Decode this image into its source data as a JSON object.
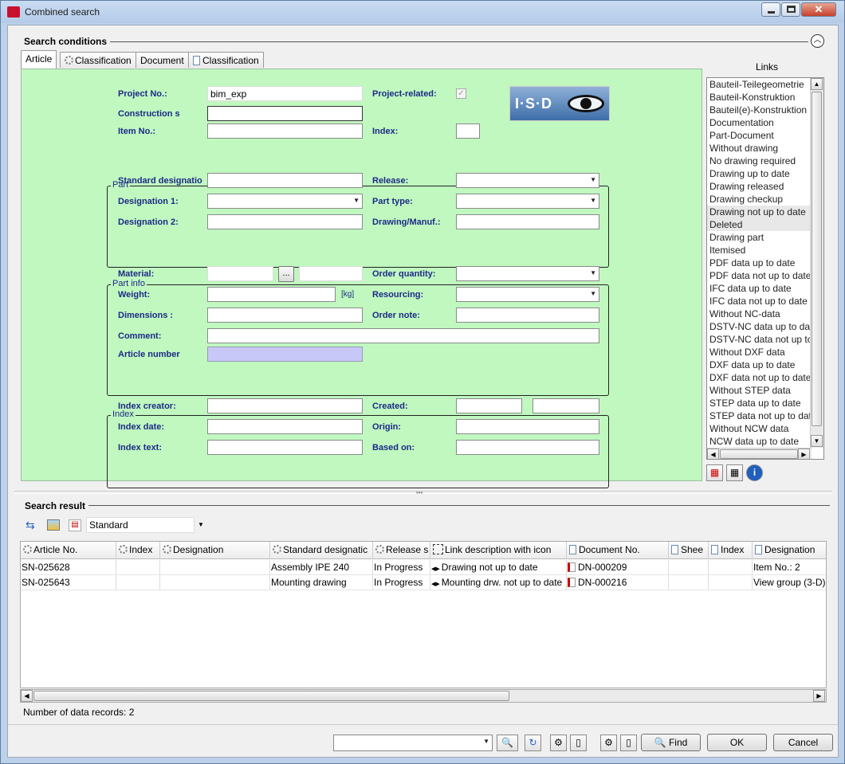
{
  "window": {
    "title": "Combined search"
  },
  "search_conditions": {
    "label": "Search conditions",
    "tabs": [
      {
        "label": "Article"
      },
      {
        "label": "Classification"
      },
      {
        "label": "Document"
      },
      {
        "label": "Classification"
      }
    ],
    "top": {
      "project_no_label": "Project No.:",
      "project_no_value": "bim_exp",
      "construction_label": "Construction s",
      "item_no_label": "Item No.:",
      "project_related_label": "Project-related:",
      "index_label": "Index:",
      "logo_text": "I·S·D"
    },
    "part": {
      "title": "Part",
      "standard_designation_label": "Standard designatio",
      "designation1_label": "Designation 1:",
      "designation2_label": "Designation 2:",
      "release_label": "Release:",
      "part_type_label": "Part type:",
      "drawing_manuf_label": "Drawing/Manuf.:"
    },
    "part_info": {
      "title": "Part info",
      "material_label": "Material:",
      "material_btn": "...",
      "weight_label": "Weight:",
      "weight_unit": "[kg]",
      "dimensions_label": "Dimensions :",
      "comment_label": "Comment:",
      "article_number_label": "Article number",
      "order_quantity_label": "Order quantity:",
      "resourcing_label": "Resourcing:",
      "order_note_label": "Order note:"
    },
    "index": {
      "title": "Index",
      "index_creator_label": "Index creator:",
      "index_date_label": "Index date:",
      "index_text_label": "Index text:",
      "created_label": "Created:",
      "origin_label": "Origin:",
      "based_on_label": "Based on:"
    }
  },
  "links": {
    "label": "Links",
    "items": [
      "Bauteil-Teilegeometrie",
      "Bauteil-Konstruktion",
      "Bauteil(e)-Konstruktion",
      "Documentation",
      "Part-Document",
      "Without drawing",
      "No drawing required",
      "Drawing up to date",
      "Drawing released",
      "Drawing checkup",
      "Drawing not up to date",
      "Deleted",
      "Drawing part",
      "Itemised",
      "PDF data up to date",
      "PDF data not up to date",
      "IFC data up to date",
      "IFC data not up to date",
      "Without NC-data",
      "DSTV-NC data up to date",
      "DSTV-NC data not up to date",
      "Without DXF data",
      "DXF data up to date",
      "DXF data not up to date",
      "Without STEP data",
      "STEP data up to date",
      "STEP data not up to date",
      "Without NCW data",
      "NCW data up to date"
    ]
  },
  "search_result": {
    "label": "Search result",
    "view_select": "Standard",
    "columns": [
      "Article No.",
      "Index",
      "Designation",
      "Standard designatic",
      "Release s",
      "Link description with icon",
      "Document No.",
      "Shee",
      "Index",
      "Designation"
    ],
    "rows": [
      [
        "SN-025628",
        "",
        "",
        "Assembly IPE 240",
        "In Progress",
        "Drawing not up to date",
        "DN-000209",
        "",
        "",
        "Item No.: 2"
      ],
      [
        "SN-025643",
        "",
        "",
        "Mounting drawing",
        "In Progress",
        "Mounting drw. not up to date",
        "DN-000216",
        "",
        "",
        "View group (3-D)"
      ]
    ],
    "record_count": "Number of data records: 2"
  },
  "footer": {
    "find_label": "Find",
    "ok_label": "OK",
    "cancel_label": "Cancel"
  },
  "colors": {
    "form_bg": "#c0f8c0",
    "label_color": "#1c2a86",
    "article_number_bg": "#c8c8f8"
  }
}
